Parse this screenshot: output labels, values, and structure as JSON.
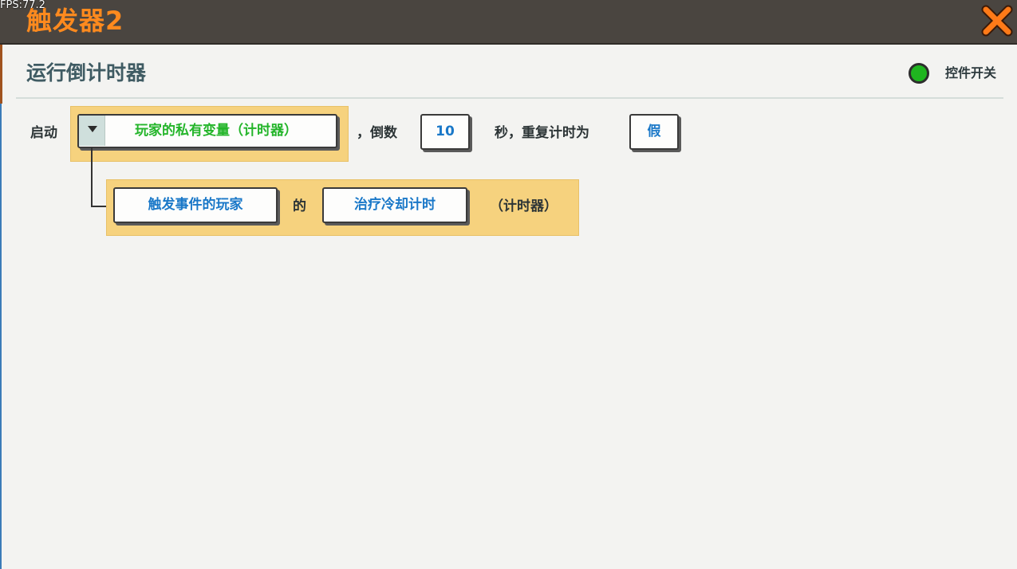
{
  "fps": "FPS:77.2",
  "window": {
    "title": "触发器2",
    "close_icon": "close-x-icon",
    "accent": "#ff8a1e"
  },
  "header": {
    "title": "运行倒计时器",
    "switch_label": "控件开关",
    "switch_color": "#1fb51f"
  },
  "row1": {
    "start": "启动",
    "variable": "玩家的私有变量（计时器）",
    "countdown": "，倒数",
    "seconds_value": "10",
    "seconds_repeat": "秒，重复计时为",
    "repeat_value": "假"
  },
  "row2": {
    "player": "触发事件的玩家",
    "of": "的",
    "variable_name": "治疗冷却计时",
    "type_hint": "（计时器）"
  }
}
